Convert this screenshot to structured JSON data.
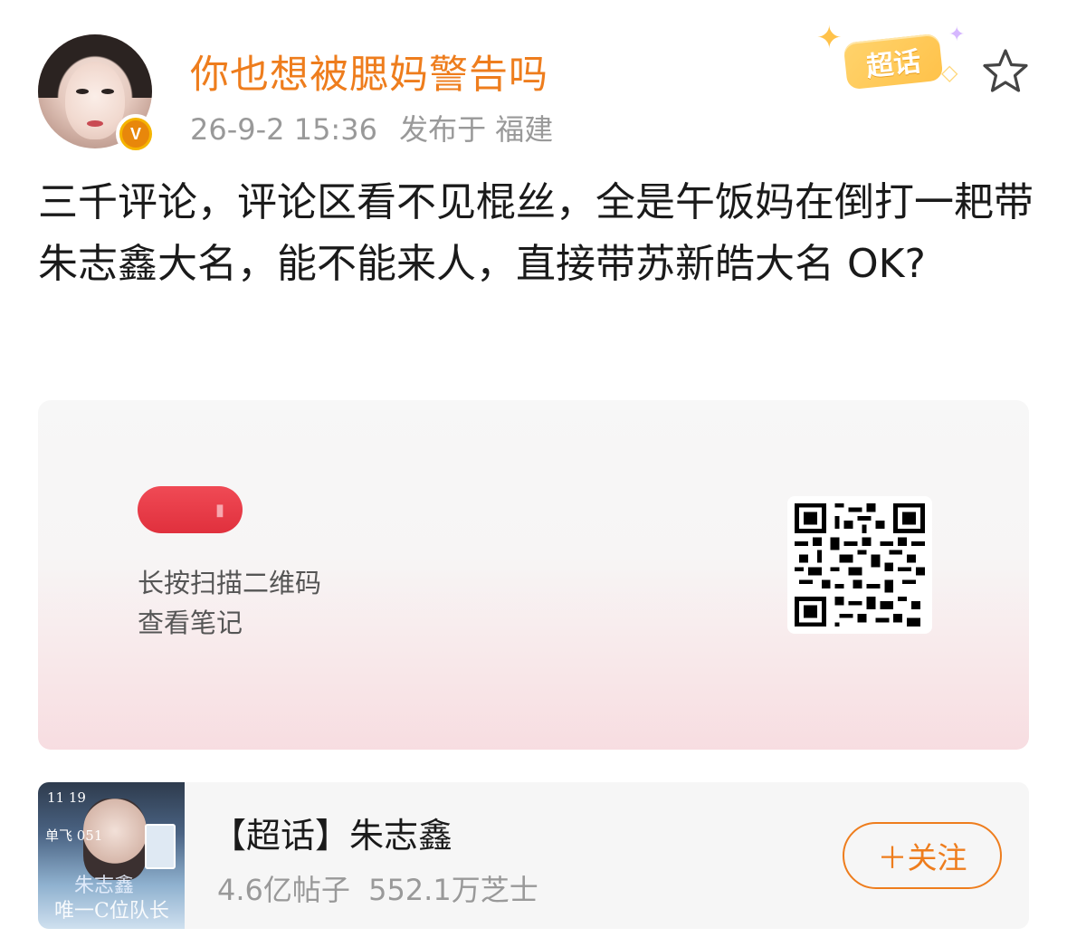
{
  "post": {
    "author": {
      "name": "你也想被腮妈警告吗",
      "verified_badge": "V"
    },
    "meta": {
      "time": "26-9-2 15:36",
      "location": "发布于 福建"
    },
    "chaohua_badge": "超话",
    "text": "三千评论，评论区看不见棍丝，全是午饭妈在倒打一耙带朱志鑫大名，能不能来人，直接带苏新皓大名 OK?",
    "qr_card": {
      "caption_line1": "长按扫描二维码",
      "caption_line2": "查看笔记"
    },
    "topic": {
      "title": "【超话】朱志鑫",
      "posts": "4.6亿帖子",
      "fans": "552.1万芝士",
      "follow_label": "＋关注",
      "thumb": {
        "date": "11 19",
        "line2": "单飞 051",
        "line3": "朱志鑫",
        "line4": "唯一C位队长"
      }
    }
  },
  "colors": {
    "accent_orange": "#ee7d1d",
    "meta_gray": "#999999",
    "text_dark": "#1a1a1a"
  }
}
